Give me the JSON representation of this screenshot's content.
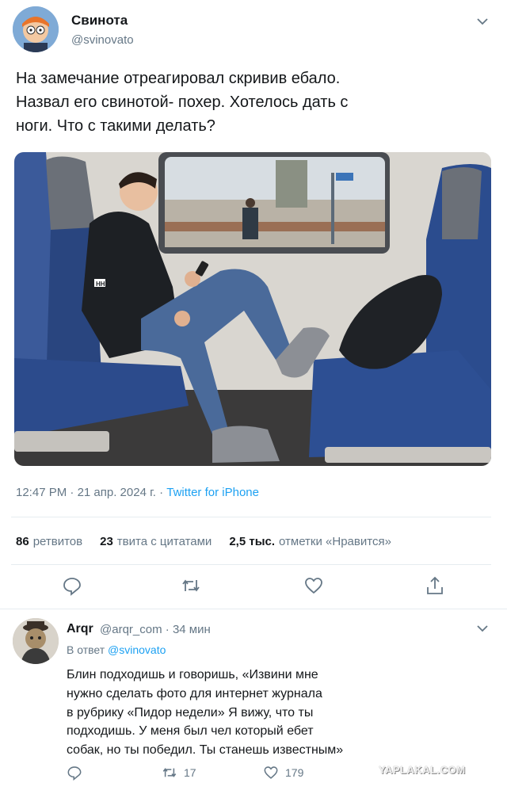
{
  "tweet": {
    "author_name": "Свинота",
    "author_handle": "@svinovato",
    "text": "На замечание отреагировал скривив ебало.\nНазвал его свинотой- похер. Хотелось дать с\nноги. Что с такими делать?",
    "time": "12:47 PM",
    "date": "21 апр. 2024 г.",
    "separator": "·",
    "source": "Twitter for iPhone",
    "stats": {
      "retweets_count": "86",
      "retweets_label": "ретвитов",
      "quotes_count": "23",
      "quotes_label": "твита с цитатами",
      "likes_count": "2,5 тыс.",
      "likes_label": "отметки «Нравится»"
    },
    "photo_icons": {
      "jacket_logo": "HH"
    }
  },
  "reply": {
    "author_name": "Arqr",
    "author_handle": "@arqr_com",
    "time_ago": "34 мин",
    "replying_prefix": "В ответ",
    "replying_to": "@svinovato",
    "text": "Блин подходишь и говоришь, «Извини мне\nнужно сделать фото для интернет журнала\nв рубрику «Пидор недели» Я вижу, что ты\nподходишь. У меня был чел который ебет\nсобак, но ты победил. Ты станешь известным»",
    "retweets": "17",
    "likes": "179"
  },
  "watermark": "YAPLAKAL.COM",
  "icons": [
    "chevron-down-icon",
    "reply-icon",
    "retweet-icon",
    "like-icon",
    "share-icon"
  ],
  "colors": {
    "accent": "#1da1f2",
    "muted": "#657786",
    "text": "#14171a",
    "divider": "#e6ecf0"
  }
}
